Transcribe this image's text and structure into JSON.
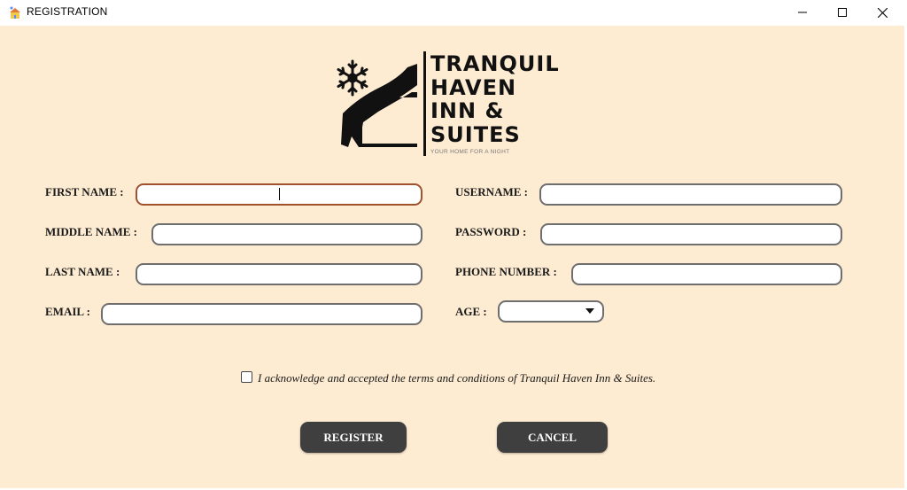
{
  "window": {
    "title": "REGISTRATION",
    "controls": [
      "minimize",
      "maximize",
      "close"
    ]
  },
  "logo": {
    "line1": "TRANQUIL",
    "line2": "HAVEN",
    "line3": "INN &",
    "line4": "SUITES",
    "tagline": "YOUR HOME FOR A NIGHT",
    "icons": [
      "snowflake-icon",
      "house-icon"
    ]
  },
  "form": {
    "first_name": {
      "label": "FIRST NAME :",
      "value": ""
    },
    "middle_name": {
      "label": "MIDDLE NAME :",
      "value": ""
    },
    "last_name": {
      "label": "LAST NAME :",
      "value": ""
    },
    "email": {
      "label": "EMAIL :",
      "value": ""
    },
    "username": {
      "label": "USERNAME :",
      "value": ""
    },
    "password": {
      "label": "PASSWORD :",
      "value": ""
    },
    "phone": {
      "label": "PHONE NUMBER :",
      "value": ""
    },
    "age": {
      "label": "AGE :",
      "value": ""
    }
  },
  "terms": {
    "checked": false,
    "text": "I acknowledge and accepted the terms and conditions of Tranquil Haven Inn & Suites."
  },
  "buttons": {
    "register": "REGISTER",
    "cancel": "CANCEL"
  },
  "colors": {
    "background": "#feecd2",
    "button": "#3f3f3f",
    "focus_border": "#a0522d"
  }
}
